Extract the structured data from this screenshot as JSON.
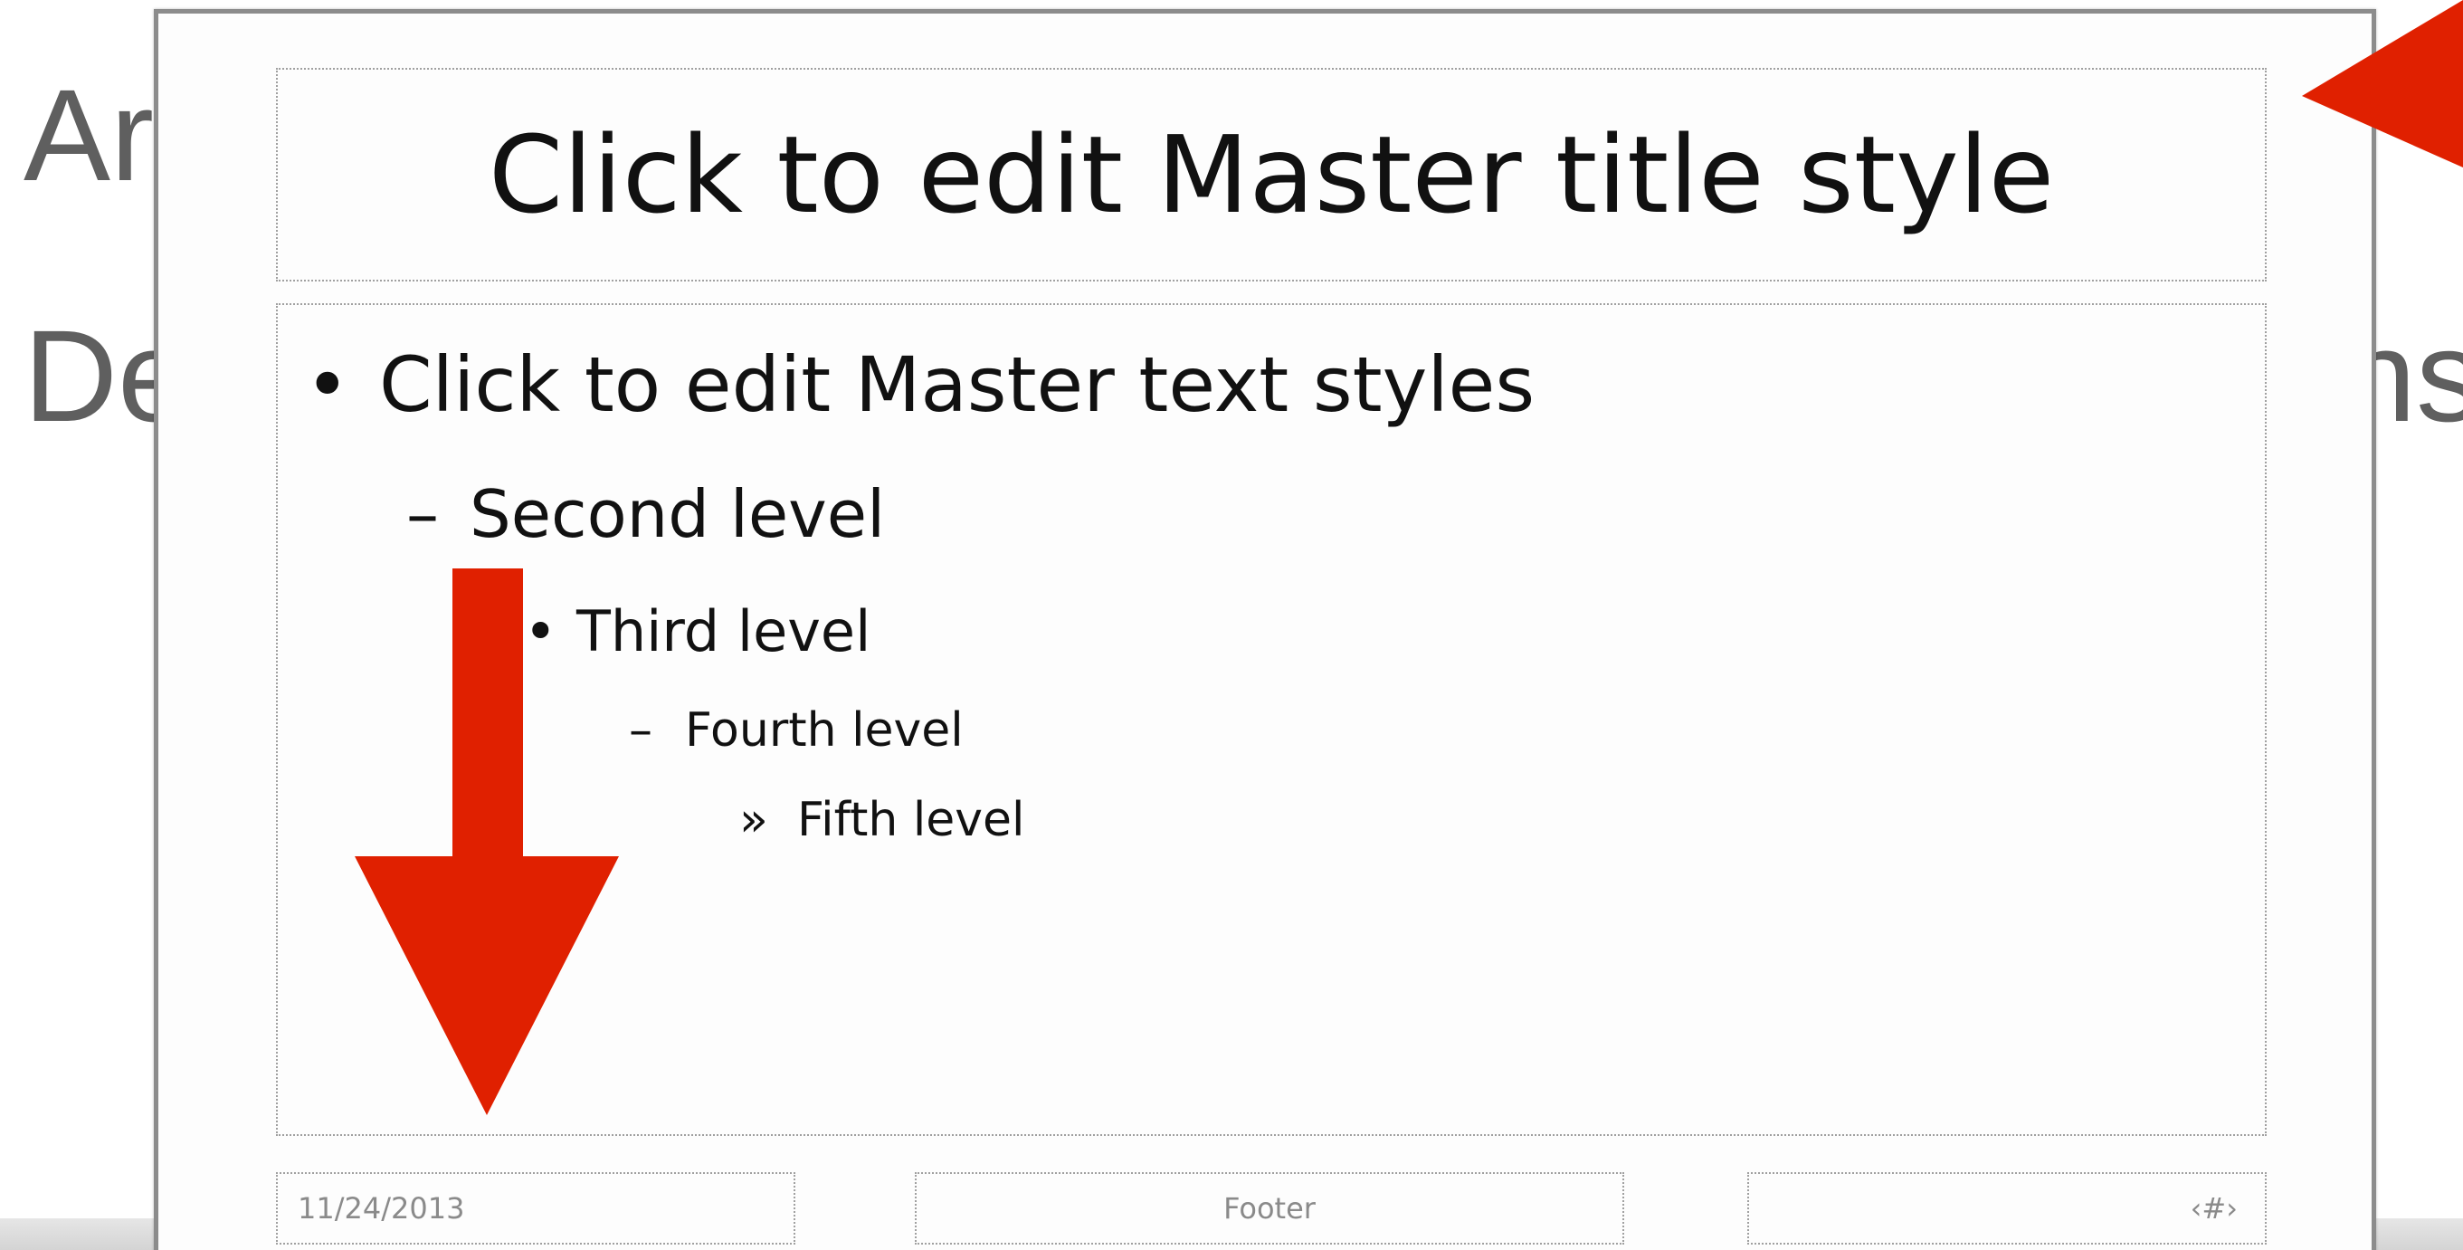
{
  "background_slide": {
    "line1_fragment": "Ar",
    "line2_fragment_left": "De",
    "line2_fragment_right": "ns"
  },
  "master_slide": {
    "title": "Click to edit Master title style",
    "body": {
      "level1": "Click to edit Master text styles",
      "level2": "Second level",
      "level3": "Third level",
      "level4": "Fourth level",
      "level5": "Fifth level"
    },
    "bullets": {
      "level1": "•",
      "level2": "–",
      "level3": "•",
      "level4": "–",
      "level5": "»"
    },
    "footer": {
      "date": "11/24/2013",
      "center": "Footer",
      "slide_number": "‹#›"
    }
  },
  "annotations": {
    "arrow_color": "#e02000",
    "arrows": [
      "down-arrow",
      "left-arrow"
    ]
  },
  "colors": {
    "background_text": "#5f5f5f",
    "slide_border": "#8c8c8c",
    "placeholder_border": "#a0a0a0",
    "footer_text": "#8a8a8a"
  }
}
